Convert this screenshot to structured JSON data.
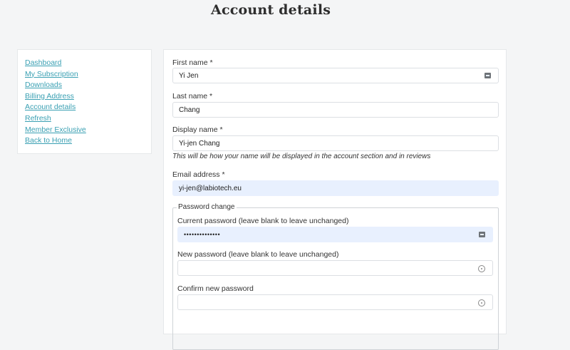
{
  "page_title": "Account details",
  "sidebar": {
    "items": [
      {
        "label": "Dashboard"
      },
      {
        "label": "My Subscription"
      },
      {
        "label": "Downloads"
      },
      {
        "label": "Billing Address"
      },
      {
        "label": "Account details"
      },
      {
        "label": "Refresh"
      },
      {
        "label": "Member Exclusive"
      },
      {
        "label": "Back to Home"
      }
    ]
  },
  "form": {
    "first_name": {
      "label": "First name *",
      "value": "Yi Jen",
      "icon": "key-icon"
    },
    "last_name": {
      "label": "Last name *",
      "value": "Chang"
    },
    "display_name": {
      "label": "Display name *",
      "value": "Yi-jen Chang",
      "hint": "This will be how your name will be displayed in the account section and in reviews"
    },
    "email": {
      "label": "Email address *",
      "value": "yi-jen@labiotech.eu"
    },
    "password_change": {
      "legend": "Password change",
      "current": {
        "label": "Current password (leave blank to leave unchanged)",
        "value": "••••••••••••••",
        "icon": "key-icon"
      },
      "new": {
        "label": "New password (leave blank to leave unchanged)",
        "value": "",
        "icon": "eye-icon"
      },
      "confirm": {
        "label": "Confirm new password",
        "value": "",
        "icon": "eye-icon"
      }
    }
  },
  "colors": {
    "link": "#3aa0b3",
    "autofill_bg": "#e8f0fe",
    "page_bg": "#f4f5f6"
  }
}
